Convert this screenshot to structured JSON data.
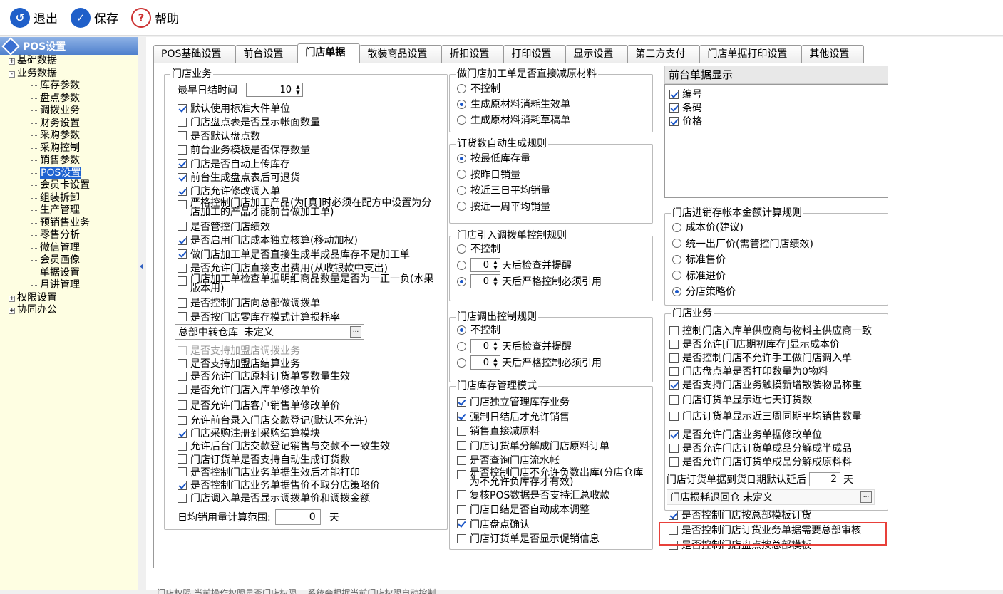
{
  "toolbar": {
    "exit": "退出",
    "save": "保存",
    "help": "帮助"
  },
  "tree": {
    "title": "POS设置",
    "items": [
      {
        "label": "基础数据",
        "kind": "top",
        "pm": "+"
      },
      {
        "label": "业务数据",
        "kind": "top",
        "pm": "-"
      },
      {
        "label": "库存参数",
        "kind": "sub"
      },
      {
        "label": "盘点参数",
        "kind": "sub"
      },
      {
        "label": "调拨业务",
        "kind": "sub"
      },
      {
        "label": "财务设置",
        "kind": "sub"
      },
      {
        "label": "采购参数",
        "kind": "sub"
      },
      {
        "label": "采购控制",
        "kind": "sub"
      },
      {
        "label": "销售参数",
        "kind": "sub"
      },
      {
        "label": "POS设置",
        "kind": "sub",
        "sel": true
      },
      {
        "label": "会员卡设置",
        "kind": "sub"
      },
      {
        "label": "组装拆卸",
        "kind": "sub"
      },
      {
        "label": "生产管理",
        "kind": "sub"
      },
      {
        "label": "预销售业务",
        "kind": "sub"
      },
      {
        "label": "零售分析",
        "kind": "sub"
      },
      {
        "label": "微信管理",
        "kind": "sub"
      },
      {
        "label": "会员画像",
        "kind": "sub"
      },
      {
        "label": "单据设置",
        "kind": "sub"
      },
      {
        "label": "月讲管理",
        "kind": "sub"
      },
      {
        "label": "权限设置",
        "kind": "top",
        "pm": "+"
      },
      {
        "label": "协同办公",
        "kind": "top",
        "pm": "+"
      }
    ]
  },
  "tabs": [
    "POS基础设置",
    "前台设置",
    "门店单据",
    "散装商品设置",
    "折扣设置",
    "打印设置",
    "显示设置",
    "第三方支付",
    "门店单据打印设置",
    "其他设置"
  ],
  "active_tab": "门店单据",
  "store_biz": {
    "title": "门店业务",
    "eod_label": "最早日结时间",
    "eod_value": "10",
    "items": [
      {
        "t": "默认使用标准大件单位",
        "on": true
      },
      {
        "t": "门店盘点表是否显示帐面数量",
        "on": false
      },
      {
        "t": "是否默认盘点数",
        "on": false
      },
      {
        "t": "前台业务模板是否保存数量",
        "on": false
      },
      {
        "t": "门店是否自动上传库存",
        "on": true
      },
      {
        "t": "前台生成盘点表后可退货",
        "on": true
      },
      {
        "t": "门店允许修改调入单",
        "on": true
      },
      {
        "t": "严格控制门店加工产品(为[真]时必须在配方中设置为分店加工的产品才能前台做加工单)",
        "on": false,
        "ml": true
      },
      {
        "t": "是否管控门店绩效",
        "on": false
      },
      {
        "t": "是否启用门店成本独立核算(移动加权)",
        "on": true
      },
      {
        "t": "做门店加工单是否直接生成半成品库存不足加工单",
        "on": true
      },
      {
        "t": "是否允许门店直接支出费用(从收银款中支出)",
        "on": false
      },
      {
        "t": "门店加工单检查单据明细商品数量是否为一正一负(水果版本用)",
        "on": false,
        "ml": true
      },
      {
        "t": "是否控制门店向总部做调拨单",
        "on": false
      },
      {
        "t": "是否按门店零库存模式计算损耗率",
        "on": false
      }
    ],
    "hq_label": "总部中转仓库",
    "hq_value": "未定义",
    "items2": [
      {
        "t": "是否支持加盟店调拨业务",
        "on": false,
        "dis": true
      },
      {
        "t": "是否支持加盟店结算业务",
        "on": false
      },
      {
        "t": "是否允许门店原料订货单零数量生效",
        "on": false
      },
      {
        "t": "是否允许门店入库单修改单价",
        "on": false
      },
      {
        "t": "是否允许门店客户销售单修改单价",
        "on": false
      },
      {
        "t": "允许前台录入门店交款登记(默认不允许)",
        "on": false
      },
      {
        "t": "门店采购注册到采购结算模块",
        "on": true
      },
      {
        "t": "允许后台门店交款登记销售与交款不一致生效",
        "on": false
      },
      {
        "t": "门店订货单是否支持自动生成订货数",
        "on": false
      },
      {
        "t": "是否控制门店业务单据生效后才能打印",
        "on": false
      },
      {
        "t": "是否控制门店业务单据售价不取分店策略价",
        "on": true
      },
      {
        "t": "门店调入单是否显示调拨单价和调拨金额",
        "on": false
      }
    ],
    "avg_label": "日均销用量计算范围:",
    "avg_value": "0",
    "avg_unit": "天"
  },
  "processing": {
    "title": "做门店加工单是否直接减原材料",
    "options": [
      "不控制",
      "生成原材料消耗生效单",
      "生成原材料消耗草稿单"
    ],
    "sel": 1
  },
  "ordergen": {
    "title": "订货数自动生成规则",
    "options": [
      "按最低库存量",
      "按昨日销量",
      "按近三日平均销量",
      "按近一周平均销量"
    ],
    "sel": 0
  },
  "transfer_in": {
    "title": "门店引入调拨单控制规则",
    "opt0": "不控制",
    "opt1": "天后检查并提醒",
    "opt2": "天后严格控制必须引用",
    "v1": "0",
    "v2": "0",
    "sel": 2
  },
  "transfer_out": {
    "title": "门店调出控制规则",
    "opt0": "不控制",
    "opt1": "天后检查并提醒",
    "opt2": "天后严格控制必须引用",
    "v1": "0",
    "v2": "0",
    "sel": 0
  },
  "inventory": {
    "title": "门店库存管理模式",
    "items": [
      {
        "t": "门店独立管理库存业务",
        "on": true
      },
      {
        "t": "强制日结后才允许销售",
        "on": true
      },
      {
        "t": "销售直接减原料",
        "on": false
      },
      {
        "t": "门店订货单分解成门店原料订单",
        "on": false
      },
      {
        "t": "是否查询门店流水帐",
        "on": false
      },
      {
        "t": "是否控制门店不允许负数出库(分店仓库为不允许负库存才有效)",
        "on": false,
        "ml": true
      },
      {
        "t": "复核POS数据是否支持汇总收款",
        "on": false
      },
      {
        "t": "门店日结是否自动成本调整",
        "on": false
      },
      {
        "t": "门店盘点确认",
        "on": true
      },
      {
        "t": "门店订货单是否显示促销信息",
        "on": false
      }
    ]
  },
  "front_display": {
    "title": "前台单据显示",
    "items": [
      {
        "t": "编号",
        "on": true
      },
      {
        "t": "条码",
        "on": true
      },
      {
        "t": "价格",
        "on": true
      }
    ]
  },
  "cost_rule": {
    "title": "门店进销存帐本金额计算规则",
    "options": [
      "成本价(建议)",
      "统一出厂价(需管控门店绩效)",
      "标准售价",
      "标准进价",
      "分店策略价"
    ],
    "sel": 4
  },
  "store_biz2": {
    "title": "门店业务",
    "items": [
      {
        "t": "控制门店入库单供应商与物料主供应商一致",
        "on": false
      },
      {
        "t": "是否允许[门店期初库存]显示成本价",
        "on": false
      },
      {
        "t": "是否控制门店不允许手工做门店调入单",
        "on": false
      },
      {
        "t": "门店盘点单是否打印数量为0物料",
        "on": false
      },
      {
        "t": "是否支持门店业务触摸新增散装物品称重",
        "on": true
      },
      {
        "t": "门店订货单显示近七天订货数",
        "on": false
      },
      {
        "t": "门店订货单显示近三周同期平均销售数量",
        "on": false
      },
      {
        "t": "是否允许门店业务单据修改单位",
        "on": true
      },
      {
        "t": "是否允许门店订货单成品分解成半成品",
        "on": false
      },
      {
        "t": "是否允许门店订货单成品分解成原料料",
        "on": false
      }
    ],
    "delay_label": "门店订货单据到货日期默认延后",
    "delay_value": "2",
    "delay_unit": "天",
    "loss_label": "门店损耗退回仓",
    "loss_value": "未定义"
  },
  "bottom": {
    "items": [
      {
        "t": "是否控制门店按总部模板订货",
        "on": true
      },
      {
        "t": "是否控制门店订货业务单据需要总部审核",
        "on": false
      },
      {
        "t": "是否控制门店盘点按总部模板",
        "on": false
      }
    ]
  },
  "status": "... 门店权限 当前操作权限是否门店权限... 系统会根据当前门店权限自动控制"
}
